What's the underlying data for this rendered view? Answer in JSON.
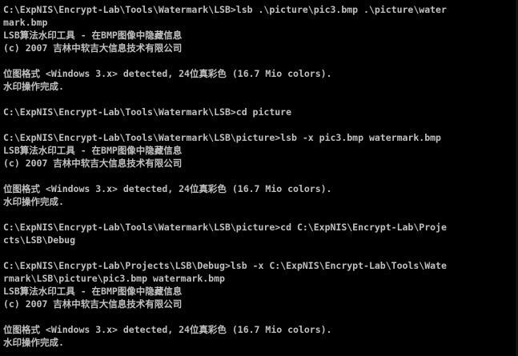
{
  "console": {
    "lines": [
      "C:\\ExpNIS\\Encrypt-Lab\\Tools\\Watermark\\LSB>lsb .\\picture\\pic3.bmp .\\picture\\water",
      "mark.bmp",
      "LSB算法水印工具 - 在BMP图像中隐藏信息",
      "(c) 2007 吉林中软吉大信息技术有限公司",
      "",
      "位图格式 <Windows 3.x> detected, 24位真彩色 (16.7 Mio colors).",
      "水印操作完成.",
      "",
      "C:\\ExpNIS\\Encrypt-Lab\\Tools\\Watermark\\LSB>cd picture",
      "",
      "C:\\ExpNIS\\Encrypt-Lab\\Tools\\Watermark\\LSB\\picture>lsb -x pic3.bmp watermark.bmp",
      "LSB算法水印工具 - 在BMP图像中隐藏信息",
      "(c) 2007 吉林中软吉大信息技术有限公司",
      "",
      "位图格式 <Windows 3.x> detected, 24位真彩色 (16.7 Mio colors).",
      "水印操作完成.",
      "",
      "C:\\ExpNIS\\Encrypt-Lab\\Tools\\Watermark\\LSB\\picture>cd C:\\ExpNIS\\Encrypt-Lab\\Proje",
      "cts\\LSB\\Debug",
      "",
      "C:\\ExpNIS\\Encrypt-Lab\\Projects\\LSB\\Debug>lsb -x C:\\ExpNIS\\Encrypt-Lab\\Tools\\Wate",
      "rmark\\LSB\\picture\\pic3.bmp watermark.bmp",
      "LSB算法水印工具 - 在BMP图像中隐藏信息",
      "(c) 2007 吉林中软吉大信息技术有限公司",
      "",
      "位图格式 <Windows 3.x> detected, 24位真彩色 (16.7 Mio colors).",
      "水印操作完成.",
      ""
    ]
  }
}
